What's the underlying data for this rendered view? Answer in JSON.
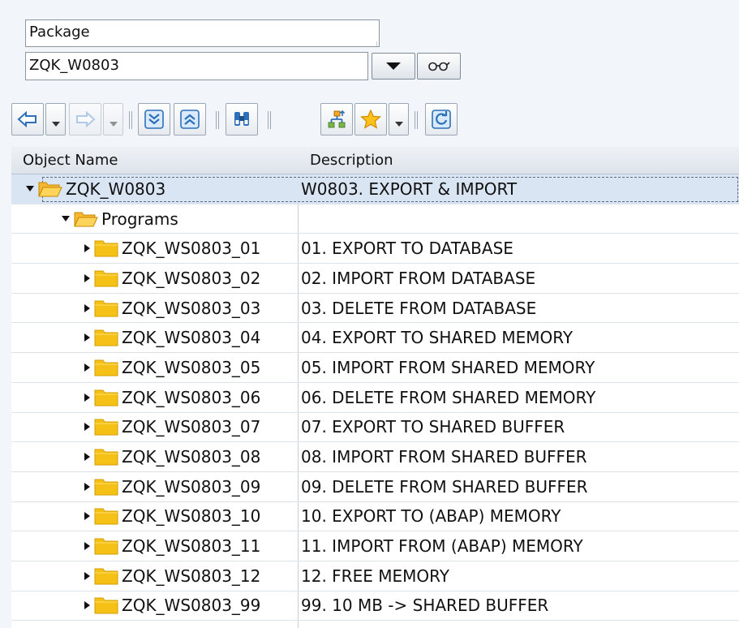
{
  "selection": {
    "object_type": "Package",
    "object_name": "ZQK_W0803"
  },
  "toolbar": {
    "buttons": [
      {
        "icon": "back-arrow-icon"
      },
      {
        "icon": "forward-arrow-icon"
      },
      {
        "icon": "expand-all-icon"
      },
      {
        "icon": "collapse-all-icon"
      },
      {
        "icon": "binoculars-find-icon"
      },
      {
        "icon": "hierarchy-icon"
      },
      {
        "icon": "star-favorites-icon"
      },
      {
        "icon": "refresh-icon"
      }
    ]
  },
  "colors": {
    "folder": "#f5c116",
    "folder_open": "#f9b928",
    "selected_row": "#d9e5f3",
    "accent_blue": "#2d6fb8"
  },
  "tree": {
    "columns": [
      "Object Name",
      "Description"
    ],
    "root": {
      "name": "ZQK_W0803",
      "description": "W0803. EXPORT & IMPORT"
    },
    "group": {
      "name": "Programs",
      "description": ""
    },
    "programs": [
      {
        "name": "ZQK_WS0803_01",
        "description": "01. EXPORT TO DATABASE"
      },
      {
        "name": "ZQK_WS0803_02",
        "description": "02. IMPORT FROM DATABASE"
      },
      {
        "name": "ZQK_WS0803_03",
        "description": "03. DELETE FROM DATABASE"
      },
      {
        "name": "ZQK_WS0803_04",
        "description": "04. EXPORT TO SHARED MEMORY"
      },
      {
        "name": "ZQK_WS0803_05",
        "description": "05. IMPORT FROM SHARED MEMORY"
      },
      {
        "name": "ZQK_WS0803_06",
        "description": "06. DELETE FROM SHARED MEMORY"
      },
      {
        "name": "ZQK_WS0803_07",
        "description": "07. EXPORT TO SHARED BUFFER"
      },
      {
        "name": "ZQK_WS0803_08",
        "description": "08. IMPORT FROM SHARED BUFFER"
      },
      {
        "name": "ZQK_WS0803_09",
        "description": "09. DELETE FROM SHARED BUFFER"
      },
      {
        "name": "ZQK_WS0803_10",
        "description": "10. EXPORT TO (ABAP) MEMORY"
      },
      {
        "name": "ZQK_WS0803_11",
        "description": "11. IMPORT FROM (ABAP) MEMORY"
      },
      {
        "name": "ZQK_WS0803_12",
        "description": "12. FREE MEMORY"
      },
      {
        "name": "ZQK_WS0803_99",
        "description": "99. 10 MB -> SHARED BUFFER"
      }
    ]
  }
}
